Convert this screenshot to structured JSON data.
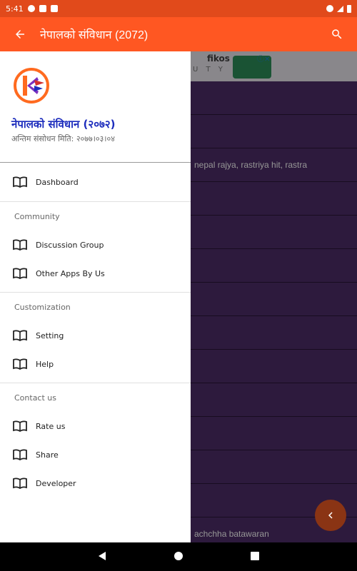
{
  "status_bar": {
    "time": "5:41"
  },
  "app_bar": {
    "title": "नेपालको संविधान (2072)"
  },
  "ad": {
    "brand": "fikos",
    "tagline": "U T Y"
  },
  "list_rows": [
    {
      "text": ""
    },
    {
      "text": ""
    },
    {
      "text": "nepal rajya, rastriya hit, rastra"
    },
    {
      "text": ""
    },
    {
      "text": ""
    },
    {
      "text": ""
    },
    {
      "text": ""
    },
    {
      "text": ""
    },
    {
      "text": ""
    },
    {
      "text": ""
    },
    {
      "text": ""
    },
    {
      "text": ""
    },
    {
      "text": ""
    },
    {
      "text": "achchha batawaran"
    }
  ],
  "drawer": {
    "title": "नेपालको संविधान (२०७२)",
    "subtitle": "अन्तिम संसोधन मिति: २०७७।०३।०४",
    "sections": [
      {
        "title": "",
        "items": [
          {
            "label": "Dashboard"
          }
        ]
      },
      {
        "title": "Community",
        "items": [
          {
            "label": "Discussion Group"
          },
          {
            "label": "Other Apps By Us"
          }
        ]
      },
      {
        "title": "Customization",
        "items": [
          {
            "label": "Setting"
          },
          {
            "label": "Help"
          }
        ]
      },
      {
        "title": "Contact us",
        "items": [
          {
            "label": "Rate us"
          },
          {
            "label": "Share"
          },
          {
            "label": "Developer"
          }
        ]
      }
    ]
  },
  "colors": {
    "status_bar": "#e14a1b",
    "app_bar": "#ff5722",
    "drawer_title": "#1d2dbd",
    "list_bg": "#4e2e6a",
    "fab": "#8a3414"
  },
  "icons": {
    "back": "arrow-left-icon",
    "search": "search-icon",
    "nav_item": "book-icon",
    "fab": "chevron-left-icon"
  }
}
